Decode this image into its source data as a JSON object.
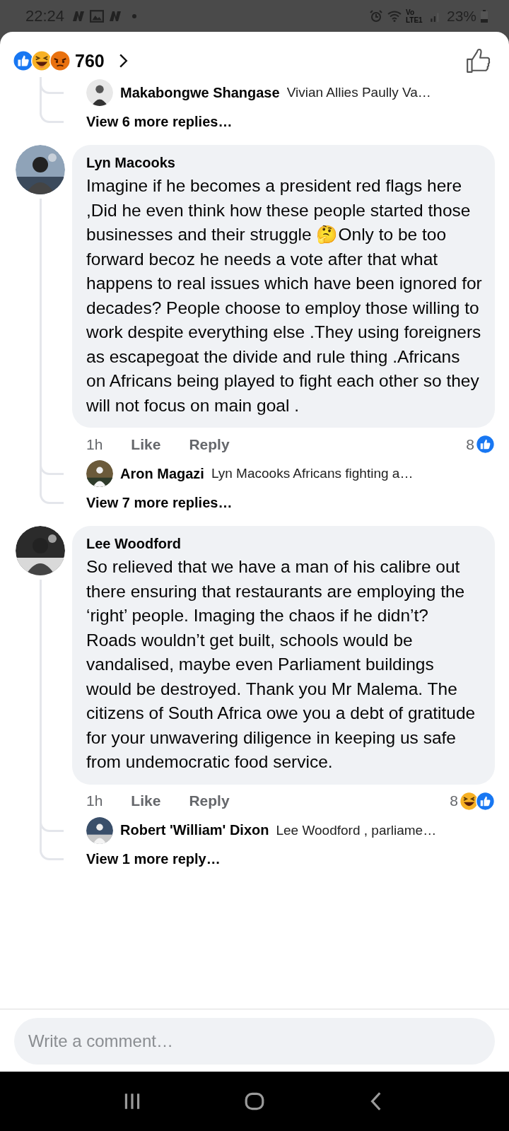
{
  "status_bar": {
    "time": "22:24",
    "network": "Vo LTE1",
    "battery": "23%"
  },
  "header": {
    "reactions": [
      {
        "kind": "like"
      },
      {
        "kind": "haha"
      },
      {
        "kind": "angry"
      }
    ],
    "count": "760"
  },
  "top_thread": {
    "replies": [
      {
        "author": "Makabongwe Shangase",
        "text": "Vivian Allies Paully Va…"
      }
    ],
    "view_more": "View 6 more replies…"
  },
  "comments": [
    {
      "author": "Lyn Macooks",
      "text": "Imagine if he becomes a president red flags here ,Did he even think how these people started those businesses and their struggle 🤔Only to be too forward becoz he needs a vote after that what happens to real issues which have been ignored for decades? People choose to employ those willing to work despite everything else .They using foreigners as escapegoat the divide and rule thing .Africans on Africans being played to fight each other so they will not focus on main goal .",
      "time": "1h",
      "like": "Like",
      "reply": "Reply",
      "reaction_count": "8",
      "reactions": [
        {
          "kind": "like"
        }
      ],
      "replies": [
        {
          "author": "Aron Magazi",
          "text": "Lyn Macooks Africans fighting  a…"
        }
      ],
      "view_more": "View 7 more replies…"
    },
    {
      "author": "Lee Woodford",
      "text": "So relieved that we have a man of his calibre out there ensuring that restaurants are employing the ‘right’ people. Imaging the chaos if he didn’t? Roads wouldn’t get built, schools would be vandalised, maybe even Parliament buildings would be destroyed. Thank you Mr Malema. The citizens of South Africa owe you a debt of gratitude for your unwavering diligence in keeping us safe from undemocratic food service.",
      "time": "1h",
      "like": "Like",
      "reply": "Reply",
      "reaction_count": "8",
      "reactions": [
        {
          "kind": "haha"
        },
        {
          "kind": "like"
        }
      ],
      "replies": [
        {
          "author": "Robert 'William' Dixon",
          "text": "Lee Woodford , parliame…"
        }
      ],
      "view_more": "View 1 more reply…"
    }
  ],
  "composer": {
    "placeholder": "Write a comment…"
  }
}
